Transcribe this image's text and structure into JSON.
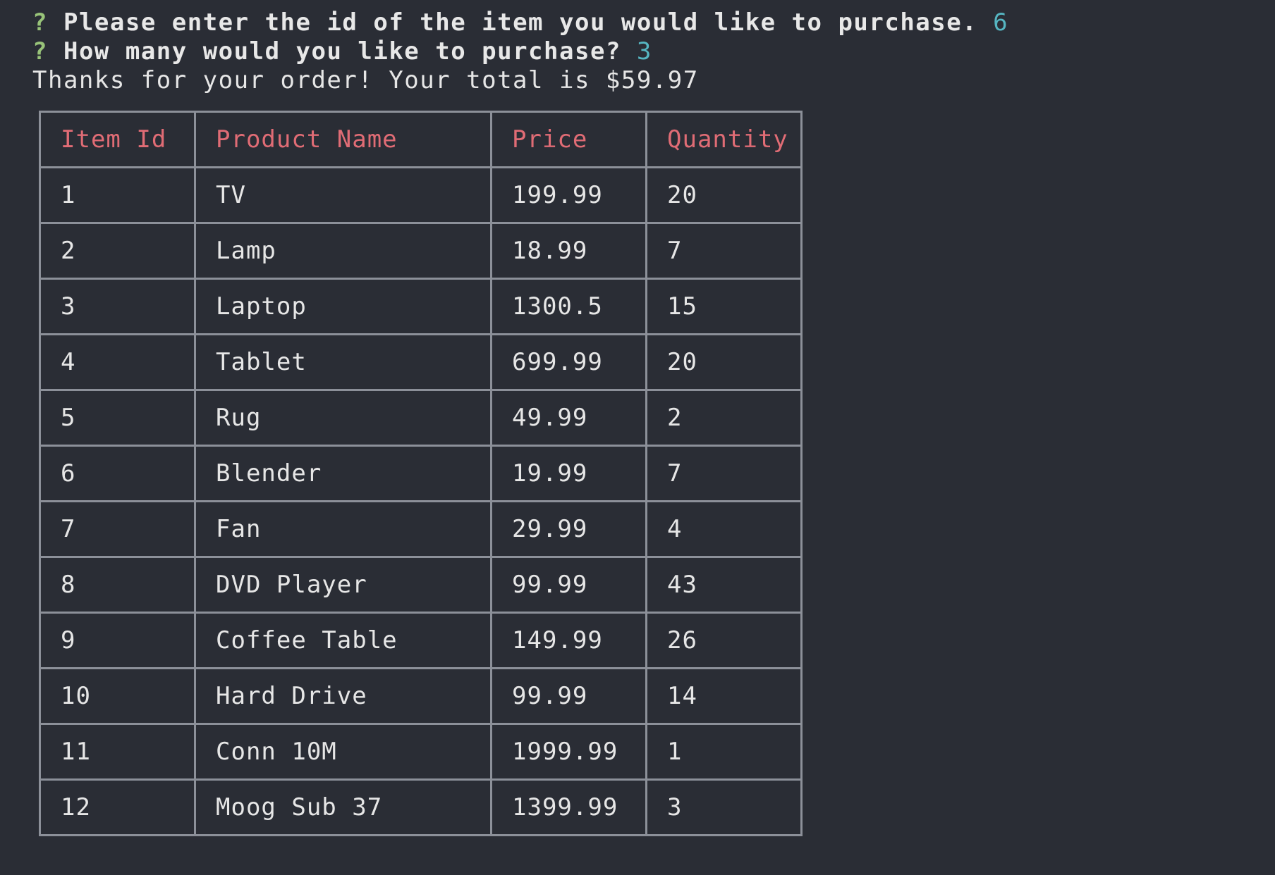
{
  "prompts": [
    {
      "mark": "?",
      "question": "Please enter the id of the item you would like to purchase.",
      "answer": "6"
    },
    {
      "mark": "?",
      "question": "How many would you like to purchase?",
      "answer": "3"
    }
  ],
  "confirmation": "Thanks for your order! Your total is $59.97",
  "table": {
    "headers": [
      "Item Id",
      "Product Name",
      "Price",
      "Quantity"
    ],
    "rows": [
      [
        "1",
        "TV",
        "199.99",
        "20"
      ],
      [
        "2",
        "Lamp",
        "18.99",
        "7"
      ],
      [
        "3",
        "Laptop",
        "1300.5",
        "15"
      ],
      [
        "4",
        "Tablet",
        "699.99",
        "20"
      ],
      [
        "5",
        "Rug",
        "49.99",
        "2"
      ],
      [
        "6",
        "Blender",
        "19.99",
        "7"
      ],
      [
        "7",
        "Fan",
        "29.99",
        "4"
      ],
      [
        "8",
        "DVD Player",
        "99.99",
        "43"
      ],
      [
        "9",
        "Coffee Table",
        "149.99",
        "26"
      ],
      [
        "10",
        "Hard Drive",
        "99.99",
        "14"
      ],
      [
        "11",
        "Conn 10M",
        "1999.99",
        "1"
      ],
      [
        "12",
        "Moog Sub 37",
        "1399.99",
        "3"
      ]
    ]
  },
  "colors": {
    "background": "#2a2d35",
    "question_mark": "#98c379",
    "answer": "#56b6c2",
    "header_text": "#e06c75",
    "border": "#8c9099"
  }
}
